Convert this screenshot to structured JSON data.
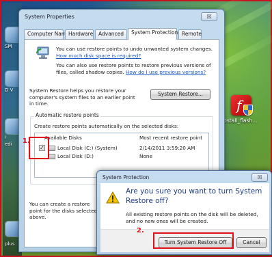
{
  "desktop": {
    "left_labels": [
      "SM",
      "D V",
      "i",
      "edi"
    ],
    "bottom_label": "plus",
    "flash_shortcut": "install_flash..."
  },
  "system_properties": {
    "title": "System Properties",
    "close_glyph": "☒",
    "tabs": [
      "Computer Name",
      "Hardware",
      "Advanced",
      "System Protection",
      "Remote"
    ],
    "active_tab": "System Protection",
    "info_line1": "You can use restore points to undo unwanted system changes.",
    "info_link1": "How much disk space is required?",
    "info_line2": "You can also use restore points to restore previous versions of files, called shadow copies.",
    "info_link2": "How do I use previous versions?",
    "sr_text": "System Restore helps you restore your computer's system files to an earlier point in time.",
    "sr_button": "System Restore...",
    "group_title": "Automatic restore points",
    "group_desc": "Create restore points automatically on the selected disks:",
    "table_headers": [
      "Available Disks",
      "Most recent restore point"
    ],
    "disks": [
      {
        "name": "Local Disk (C:) (System)",
        "restore_point": "2/14/2011 3:59:20 AM",
        "checked": true
      },
      {
        "name": "Local Disk (D:)",
        "restore_point": "None",
        "checked": false
      }
    ],
    "footer_text": "You can create a restore point for the disks selected above."
  },
  "annotations": {
    "step1": "1.",
    "step2": "2.",
    "color": "#e0101a"
  },
  "confirm_dialog": {
    "title": "System Protection",
    "close_glyph": "☒",
    "question": "Are you sure you want to turn System Restore off?",
    "detail": "All existing restore points on the disk will be deleted, and no new ones will be created.",
    "primary_button": "Turn System Restore Off",
    "cancel_button": "Cancel",
    "icon": "warning-icon"
  }
}
